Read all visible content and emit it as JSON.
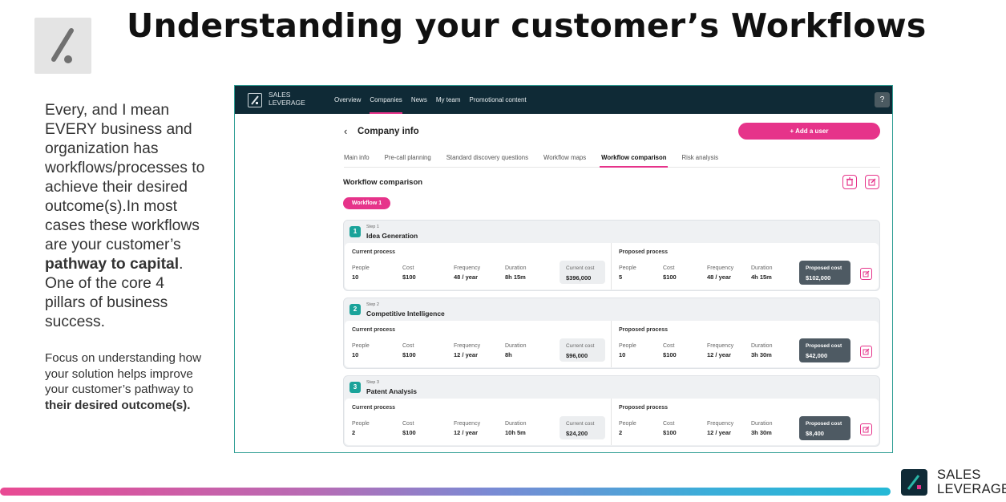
{
  "slide": {
    "title": "Understanding your customer’s Workflows",
    "para1_a": "Every, and I mean EVERY business and organization has workflows/processes to achieve their desired outcome(s).In most cases these workflows are your customer’s ",
    "para1_bold": "pathway to capital",
    "para1_b": ". One of the core 4 pillars of business success.",
    "para2_a": "Focus on understanding how your solution helps improve your customer’s pathway to ",
    "para2_bold": "their desired outcome(s).",
    "footer_logo_line1": "SALES",
    "footer_logo_line2": "LEVERAGE"
  },
  "app": {
    "logo_line1": "SALES",
    "logo_line2": "LEVERAGE",
    "nav": [
      "Overview",
      "Companies",
      "News",
      "My team",
      "Promotional content"
    ],
    "help_icon": "?",
    "back_icon": "‹",
    "company_title": "Company info",
    "add_user_label": "+ Add a user",
    "tabs": [
      "Main info",
      "Pre-call planning",
      "Standard discovery questions",
      "Workflow maps",
      "Workflow comparison",
      "Risk analysis"
    ],
    "section_title": "Workflow comparison",
    "workflow_pill": "Workflow 1",
    "labels": {
      "current_process": "Current process",
      "proposed_process": "Proposed process",
      "people": "People",
      "cost": "Cost",
      "frequency": "Frequency",
      "duration": "Duration",
      "current_cost": "Current cost",
      "proposed_cost": "Proposed cost"
    },
    "steps": [
      {
        "num": "1",
        "step_label": "Step 1",
        "name": "Idea Generation",
        "current": {
          "people": "10",
          "cost": "$100",
          "frequency": "48 / year",
          "duration": "8h 15m",
          "total": "$396,000"
        },
        "proposed": {
          "people": "5",
          "cost": "$100",
          "frequency": "48 / year",
          "duration": "4h 15m",
          "total": "$102,000"
        }
      },
      {
        "num": "2",
        "step_label": "Step 2",
        "name": "Competitive Intelligence",
        "current": {
          "people": "10",
          "cost": "$100",
          "frequency": "12 / year",
          "duration": "8h",
          "total": "$96,000"
        },
        "proposed": {
          "people": "10",
          "cost": "$100",
          "frequency": "12 / year",
          "duration": "3h 30m",
          "total": "$42,000"
        }
      },
      {
        "num": "3",
        "step_label": "Step 3",
        "name": "Patent Analysis",
        "current": {
          "people": "2",
          "cost": "$100",
          "frequency": "12 / year",
          "duration": "10h 5m",
          "total": "$24,200"
        },
        "proposed": {
          "people": "2",
          "cost": "$100",
          "frequency": "12 / year",
          "duration": "3h 30m",
          "total": "$8,400"
        }
      }
    ]
  },
  "colors": {
    "accent": "#e6338a",
    "nav_bg": "#0f2a36",
    "teal": "#1aa39a"
  },
  "icons": {
    "slide_logo": "pencil-slash-icon",
    "delete": "trash-icon",
    "edit": "edit-icon",
    "help": "help-circle-icon"
  }
}
